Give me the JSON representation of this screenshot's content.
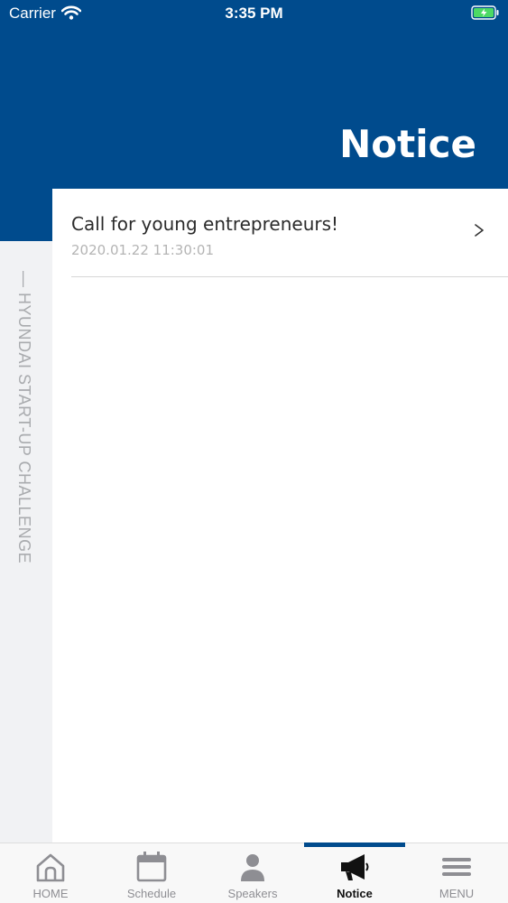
{
  "status_bar": {
    "carrier": "Carrier",
    "time": "3:35 PM"
  },
  "header": {
    "title": "Notice"
  },
  "side_label": "— HYUNDAI START-UP CHALLENGE",
  "notices": [
    {
      "title": "Call for young entrepreneurs!",
      "date": "2020.01.22 11:30:01"
    }
  ],
  "tabs": [
    {
      "label": "HOME",
      "icon": "home-icon"
    },
    {
      "label": "Schedule",
      "icon": "calendar-icon"
    },
    {
      "label": "Speakers",
      "icon": "person-icon"
    },
    {
      "label": "Notice",
      "icon": "megaphone-icon",
      "active": true
    },
    {
      "label": "MENU",
      "icon": "hamburger-menu-icon"
    }
  ],
  "colors": {
    "brand_blue": "#004b8d",
    "inactive_tab": "#8e8e93",
    "battery_green": "#4cd964"
  }
}
